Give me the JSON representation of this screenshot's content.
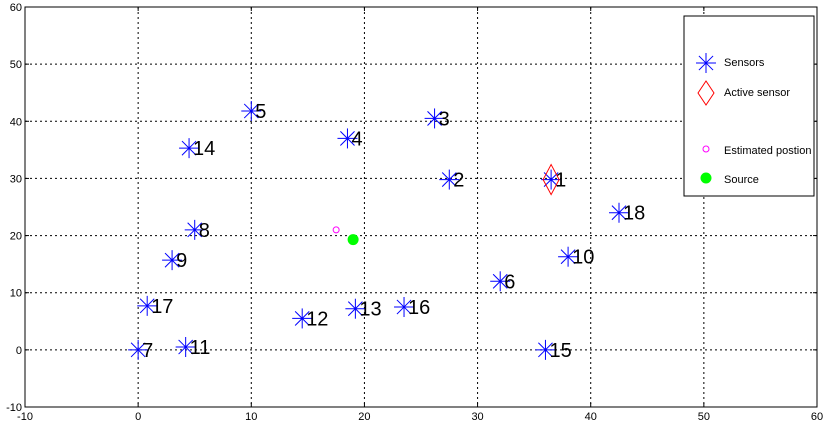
{
  "chart_data": {
    "type": "scatter",
    "xlim": [
      -10,
      60
    ],
    "ylim": [
      -10,
      60
    ],
    "x_ticks": [
      -10,
      0,
      10,
      20,
      30,
      40,
      50,
      60
    ],
    "y_ticks": [
      -10,
      0,
      10,
      20,
      30,
      40,
      50,
      60
    ],
    "grid": true,
    "legend_position": "top-right",
    "series": [
      {
        "name": "Sensors",
        "marker": "asterisk",
        "color": "#0000ff",
        "points": [
          {
            "label": "1",
            "x": 36.5,
            "y": 29.8
          },
          {
            "label": "2",
            "x": 27.5,
            "y": 29.8
          },
          {
            "label": "3",
            "x": 26.2,
            "y": 40.5
          },
          {
            "label": "4",
            "x": 18.5,
            "y": 37.0
          },
          {
            "label": "5",
            "x": 10.0,
            "y": 41.8
          },
          {
            "label": "6",
            "x": 32.0,
            "y": 12.0
          },
          {
            "label": "7",
            "x": 0.0,
            "y": 0.0
          },
          {
            "label": "8",
            "x": 5.0,
            "y": 21.0
          },
          {
            "label": "9",
            "x": 3.0,
            "y": 15.7
          },
          {
            "label": "10",
            "x": 38.0,
            "y": 16.3
          },
          {
            "label": "11",
            "x": 4.2,
            "y": 0.5
          },
          {
            "label": "12",
            "x": 14.5,
            "y": 5.5
          },
          {
            "label": "13",
            "x": 19.2,
            "y": 7.2
          },
          {
            "label": "14",
            "x": 4.5,
            "y": 35.3
          },
          {
            "label": "15",
            "x": 36.0,
            "y": 0.0
          },
          {
            "label": "16",
            "x": 23.5,
            "y": 7.5
          },
          {
            "label": "17",
            "x": 0.8,
            "y": 7.7
          },
          {
            "label": "18",
            "x": 42.5,
            "y": 24.0
          }
        ]
      },
      {
        "name": "Active sensor",
        "marker": "diamond",
        "color": "#ff0000",
        "points": [
          {
            "x": 36.5,
            "y": 29.8
          }
        ]
      },
      {
        "name": "Estimated postion",
        "marker": "circle-open",
        "color": "#ff00ff",
        "points": [
          {
            "x": 17.5,
            "y": 21.0
          }
        ]
      },
      {
        "name": "Source",
        "marker": "circle-filled",
        "color": "#00ff00",
        "points": [
          {
            "x": 19.0,
            "y": 19.3
          }
        ]
      }
    ]
  }
}
